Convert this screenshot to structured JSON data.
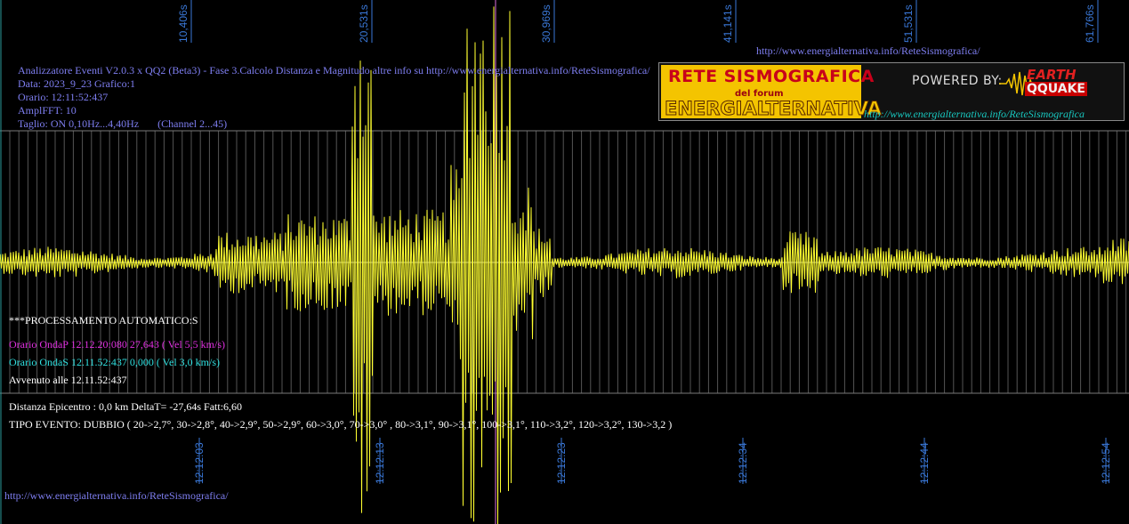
{
  "header": {
    "url_top": "http://www.energialternativa.info/ReteSismografica/",
    "info_lines": [
      "Analizzatore Eventi V2.0.3 x QQ2 (Beta3) - Fase 3.Calcolo Distanza e Magnitudo altre info su http://www.energialternativa.info/ReteSismografica/",
      "Data: 2023_9_23 Grafico:1",
      "Orario: 12:11:52:437",
      "AmplFFT: 10",
      "Taglio: ON 0,10Hz...4,40Hz       (Channel 2...45)"
    ]
  },
  "logo": {
    "line1": "RETE SISMOGRAFICA",
    "line2": "del forum",
    "line3": "ENERGIALTERNATIVA",
    "powered_by": "POWERED BY:",
    "brand_top": "EARTH",
    "brand_bottom": "QQUAKE",
    "site": "http://www.energialternativa.info/ReteSismografica"
  },
  "top_axis_labels": [
    "10,406s",
    "20,531s",
    "30,969s",
    "41,141s",
    "51,531s",
    "61,766s"
  ],
  "bottom_axis_labels": [
    "12:12:03",
    "12:12:13",
    "12:12:23",
    "12:12:34",
    "12:12:44",
    "12:12:54"
  ],
  "processing": {
    "title": "***PROCESSAMENTO AUTOMATICO:S",
    "p_wave": "Orario OndaP 12.12.20:080  27,643 ( Vel 5,5 km/s)",
    "s_wave": "Orario OndaS 12.11.52:437  0,000 ( Vel 3,0 km/s)",
    "happened": "Avvenuto alle 12.11.52:437",
    "distance": "Distanza Epicentro : 0,0 km DeltaT= -27,64s  Fatt:6,60",
    "event_type": "TIPO EVENTO: DUBBIO ( 20->2,7°, 30->2,8°, 40->2,9°, 50->2,9°, 60->3,0°, 70->3,0° , 80->3,1°, 90->3,1°, 100->3,1°, 110->3,2°, 120->3,2°, 130->3,2 )"
  },
  "footer": {
    "url": "http://www.energialternativa.info/ReteSismografica/"
  },
  "colors": {
    "background": "#000000",
    "trace": "#ffff30",
    "grid": "#6a6a6a",
    "axis_label": "#3a78d8",
    "info_text": "#7e7ef0",
    "p_wave": "#e030e0",
    "s_wave": "#30e0e0",
    "marker_line": "#e070e0"
  }
}
